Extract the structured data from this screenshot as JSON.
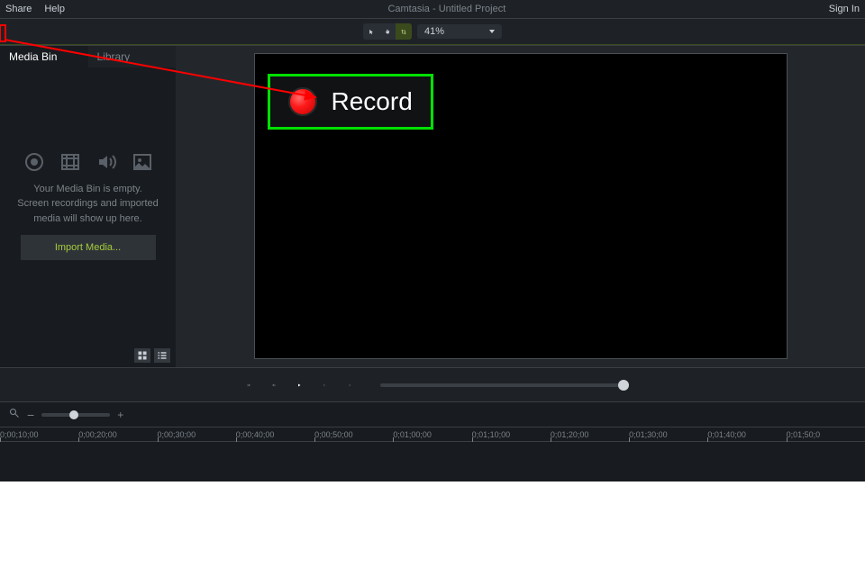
{
  "menubar": {
    "share": "Share",
    "help": "Help",
    "title": "Camtasia - Untitled Project",
    "signin": "Sign In"
  },
  "toolbar": {
    "zoom_level": "41%"
  },
  "tabs": {
    "media_bin": "Media Bin",
    "library": "Library"
  },
  "media_panel": {
    "empty_text": "Your Media Bin is empty.\nScreen recordings and imported\nmedia will show up here.",
    "import_label": "Import Media..."
  },
  "callout": {
    "record_label": "Record"
  },
  "timeline": {
    "ticks": [
      "0;00;10;00",
      "0;00;20;00",
      "0;00;30;00",
      "0;00;40;00",
      "0;00;50;00",
      "0;01;00;00",
      "0;01;10;00",
      "0;01;20;00",
      "0;01;30;00",
      "0;01;40;00",
      "0;01;50;0"
    ]
  }
}
